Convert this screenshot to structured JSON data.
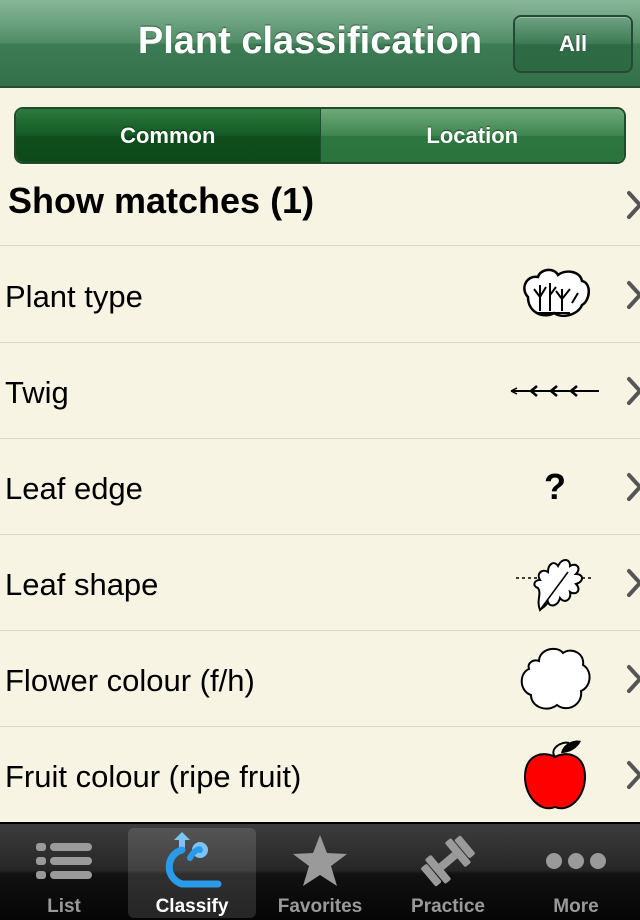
{
  "nav": {
    "title": "Plant classification",
    "all_label": "All"
  },
  "segments": [
    {
      "label": "Common",
      "selected": true
    },
    {
      "label": "Location",
      "selected": false
    }
  ],
  "matches": {
    "label": "Show matches (1)"
  },
  "rows": [
    {
      "label": "Plant type",
      "icon": "shrub-icon"
    },
    {
      "label": "Twig",
      "icon": "twig-icon"
    },
    {
      "label": "Leaf edge",
      "icon": "unknown-icon",
      "value": "?"
    },
    {
      "label": "Leaf shape",
      "icon": "oak-leaf-icon"
    },
    {
      "label": "Flower colour (f/h)",
      "icon": "flower-white-icon",
      "color": "#ffffff"
    },
    {
      "label": "Fruit colour (ripe fruit)",
      "icon": "red-apple-icon",
      "color": "#ff0000"
    }
  ],
  "tabs": [
    {
      "label": "List",
      "icon": "list-icon",
      "selected": false
    },
    {
      "label": "Classify",
      "icon": "classify-icon",
      "selected": true
    },
    {
      "label": "Favorites",
      "icon": "star-icon",
      "selected": false
    },
    {
      "label": "Practice",
      "icon": "dumbbell-icon",
      "selected": false
    },
    {
      "label": "More",
      "icon": "more-dots-icon",
      "selected": false
    }
  ],
  "colors": {
    "nav_green": "#3d7c55",
    "background": "#f8f4e4",
    "apple_red": "#ff0000"
  }
}
